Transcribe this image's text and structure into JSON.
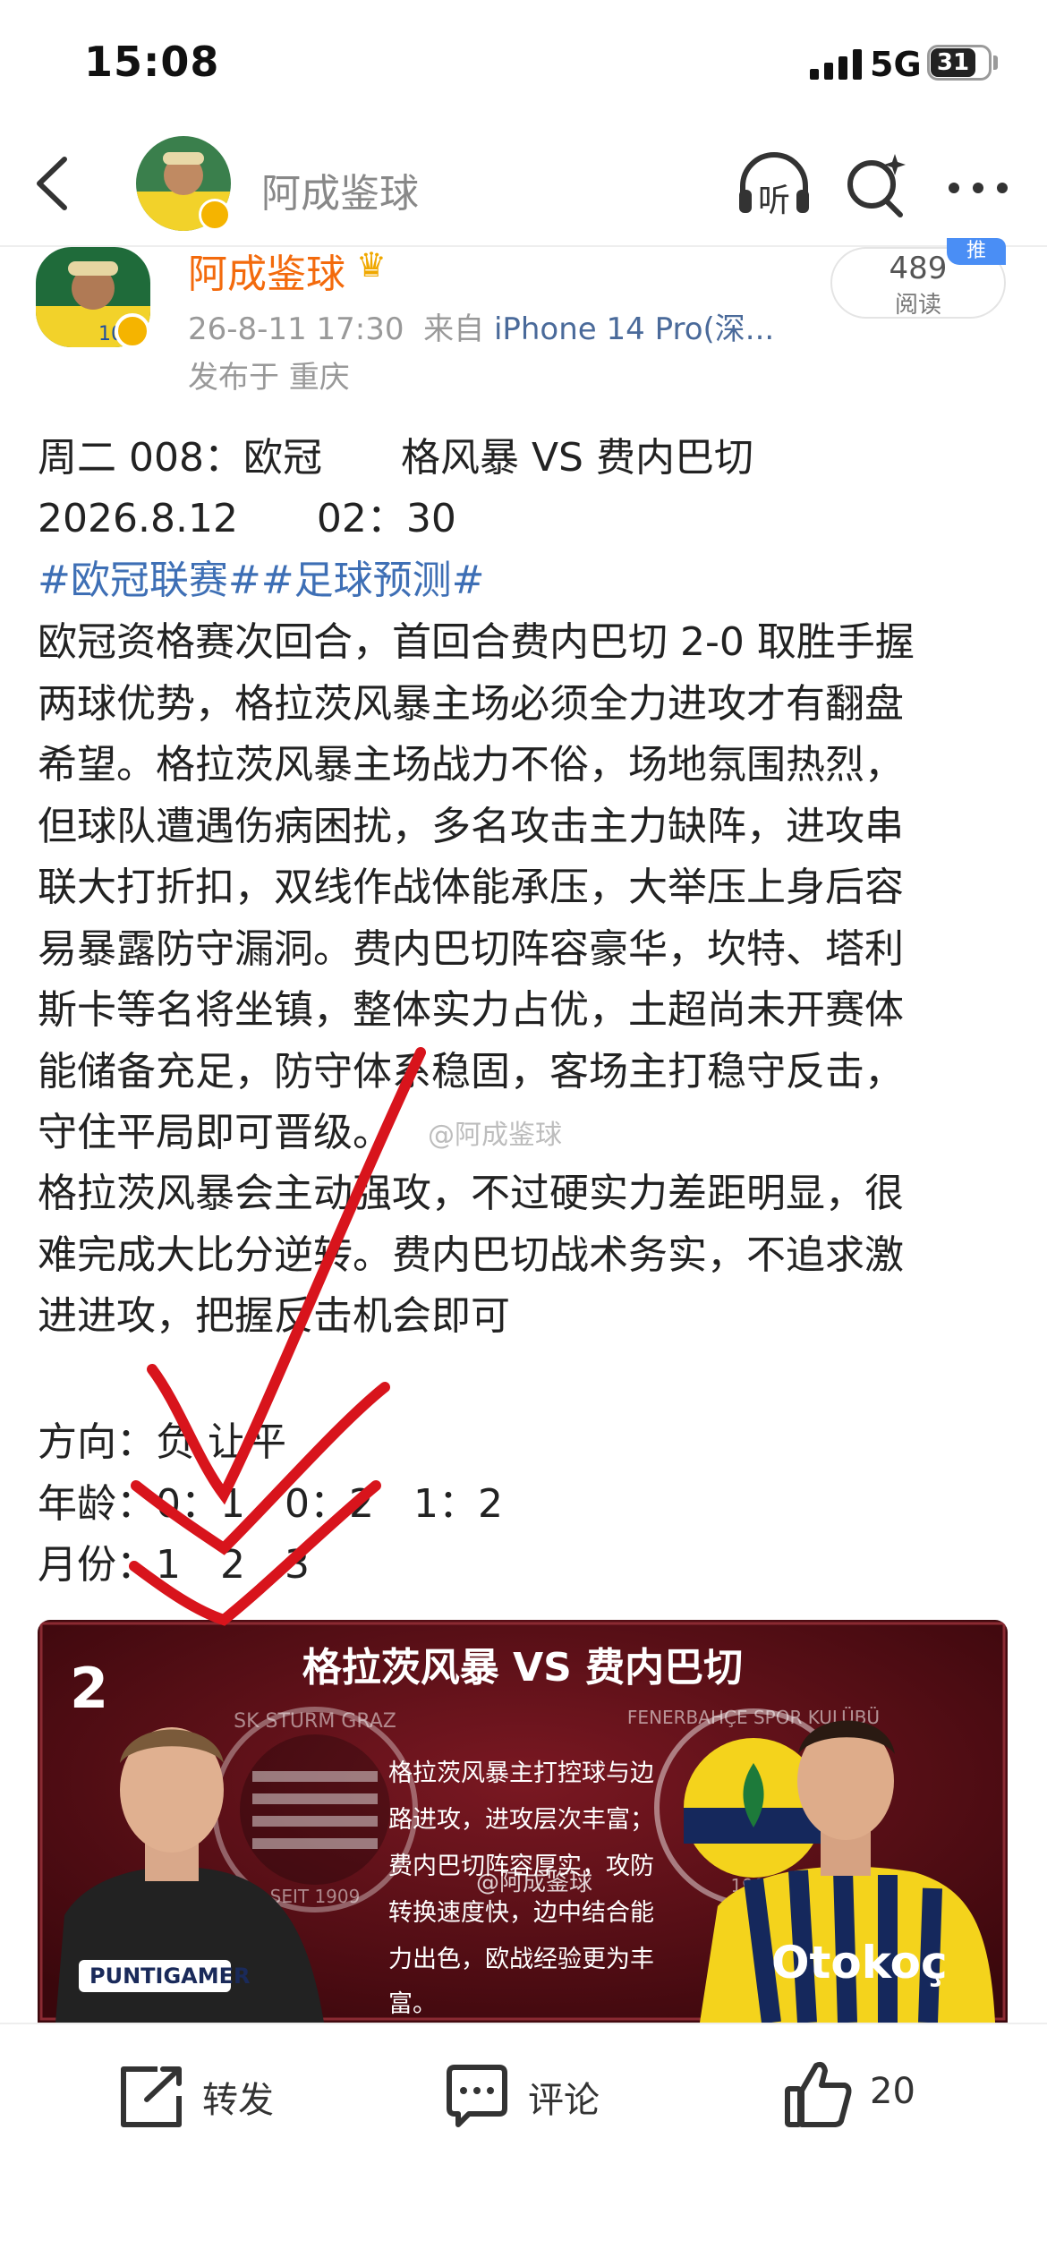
{
  "status_bar": {
    "time": "15:08",
    "network": "5G",
    "battery": "31"
  },
  "nav": {
    "title": "阿成鉴球",
    "listen_label": "听"
  },
  "post": {
    "author": "阿成鉴球",
    "timestamp": "26-8-11 17:30",
    "source_prefix": "来自",
    "device": "iPhone 14 Pro(深...",
    "location": "发布于 重庆",
    "reads_count": "489",
    "reads_label": "阅读",
    "recommend_tag": "推",
    "lines": [
      "周二 008：欧冠　　格风暴 VS 费内巴切",
      "2026.8.12　　02：30"
    ],
    "hashtags": "#欧冠联赛##足球预测#",
    "body_lines": [
      "欧冠资格赛次回合，首回合费内巴切 2-0 取胜手握",
      "两球优势，格拉茨风暴主场必须全力进攻才有翻盘",
      "希望。格拉茨风暴主场战力不俗，场地氛围热烈，",
      "但球队遭遇伤病困扰，多名攻击主力缺阵，进攻串",
      "联大打折扣，双线作战体能承压，大举压上身后容",
      "易暴露防守漏洞。费内巴切阵容豪华，坎特、塔利",
      "斯卡等名将坐镇，整体实力占优，土超尚未开赛体",
      "能储备充足，防守体系稳固，客场主打稳守反击，",
      "守住平局即可晋级。",
      "格拉茨风暴会主动强攻，不过硬实力差距明显，很",
      "难完成大比分逆转。费内巴切战术务实，不追求激",
      "进进攻，把握反击机会即可"
    ],
    "watermark": "@阿成鉴球",
    "prediction": {
      "direction": "方向：负 让平",
      "age": "年龄：0：1　0：2　1：2",
      "month": "月份：1　2　3"
    }
  },
  "promo_image": {
    "number": "2",
    "title": "格拉茨风暴 VS 费内巴切",
    "text_lines": [
      "格拉茨风暴主打控球与边",
      "路进攻，进攻层次丰富；",
      "费内巴切阵容厚实，攻防",
      "转换速度快，边中结合能",
      "力出色，欧战经验更为丰",
      "富。"
    ],
    "watermark": "@阿成鉴球",
    "left_badge": "SK STURM GRAZ",
    "left_badge_bottom": "SEIT 1909",
    "right_badge": "FENERBAHÇE SPOR KULÜBÜ",
    "right_badge_year": "1907",
    "left_sponsor": "PUNTIGAMER",
    "right_sponsor": "Otokoç"
  },
  "bottom_bar": {
    "repost": "转发",
    "comment": "评论",
    "like_count": "20"
  },
  "colors": {
    "author": "#f36a0c",
    "hashtag": "#3e6fb5",
    "check_color": "#d8141c"
  }
}
